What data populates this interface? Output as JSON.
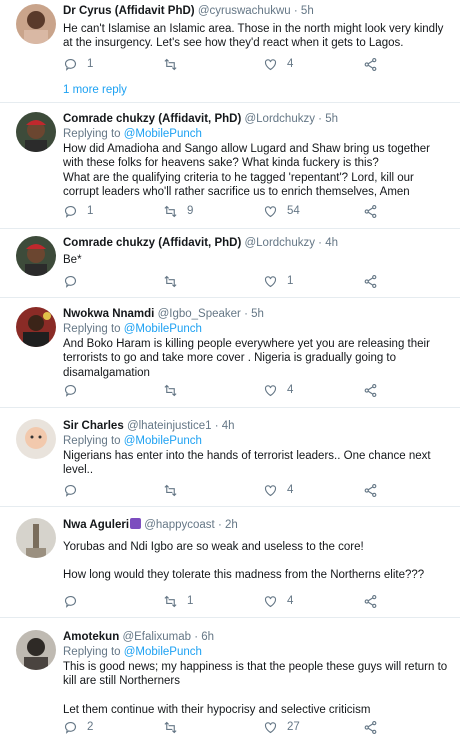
{
  "tweets": [
    {
      "name": "Dr Cyrus (Affidavit PhD)",
      "handle": "@cyruswachukwu",
      "dot": "·",
      "time": "5h",
      "replying_prefix": "",
      "replying_to": "",
      "body": [
        "He can't Islamise an Islamic area. Those in the north might look very kindly at the insurgency. Let's see how they'd react when it gets to Lagos."
      ],
      "replies": "1",
      "retweets": "",
      "likes": "4"
    },
    {
      "name": "Comrade chukzy (Affidavit, PhD)",
      "handle": "@Lordchukzy",
      "dot": "·",
      "time": "5h",
      "replying_prefix": "Replying to ",
      "replying_to": "@MobilePunch",
      "body": [
        "How did Amadioha and Sango allow Lugard and Shaw bring us together with these folks for heavens sake? What kinda fuckery is this?",
        "What are the qualifying criteria to he tagged 'repentant'? Lord, kill our corrupt leaders who'll rather sacrifice us to enrich themselves, Amen"
      ],
      "replies": "1",
      "retweets": "9",
      "likes": "54"
    },
    {
      "name": "Comrade chukzy (Affidavit, PhD)",
      "handle": "@Lordchukzy",
      "dot": "·",
      "time": "4h",
      "replying_prefix": "",
      "replying_to": "",
      "body": [
        "Be*"
      ],
      "replies": "",
      "retweets": "",
      "likes": "1"
    },
    {
      "name": "Nwokwa Nnamdi",
      "handle": "@Igbo_Speaker",
      "dot": "·",
      "time": "5h",
      "replying_prefix": "Replying to ",
      "replying_to": "@MobilePunch",
      "body": [
        "And Boko Haram is killing people everywhere yet you are releasing their terrorists to go and take more cover . Nigeria is gradually going to disamalgamation"
      ],
      "replies": "",
      "retweets": "",
      "likes": "4"
    },
    {
      "name": "Sir Charles",
      "handle": "@lhateinjustice1",
      "dot": "·",
      "time": "4h",
      "replying_prefix": "Replying to ",
      "replying_to": "@MobilePunch",
      "body": [
        "Nigerians has enter into the hands of terrorist leaders.. One chance next level.."
      ],
      "replies": "",
      "retweets": "",
      "likes": "4"
    },
    {
      "name": "Nwa Aguleri",
      "handle": "@happycoast",
      "dot": "·",
      "time": "2h",
      "replying_prefix": "",
      "replying_to": "",
      "body": [
        "Yorubas and Ndi Igbo are so weak and useless to the core!",
        "How long would they tolerate this madness from the Northerns elite???"
      ],
      "replies": "",
      "retweets": "1",
      "likes": "4"
    },
    {
      "name": "Amotekun",
      "handle": "@Efalixumab",
      "dot": "·",
      "time": "6h",
      "replying_prefix": "Replying to ",
      "replying_to": "@MobilePunch",
      "body": [
        "This is good news; my happiness is that the people these guys will return to kill are still Northerners",
        "Let them continue with their hypocrisy and selective criticism"
      ],
      "replies": "2",
      "retweets": "",
      "likes": "27"
    }
  ],
  "more_reply": "1 more reply",
  "colors": {
    "accent": "#1da1f2",
    "muted": "#657786",
    "text": "#14171a",
    "divider": "#e6ecf0"
  }
}
